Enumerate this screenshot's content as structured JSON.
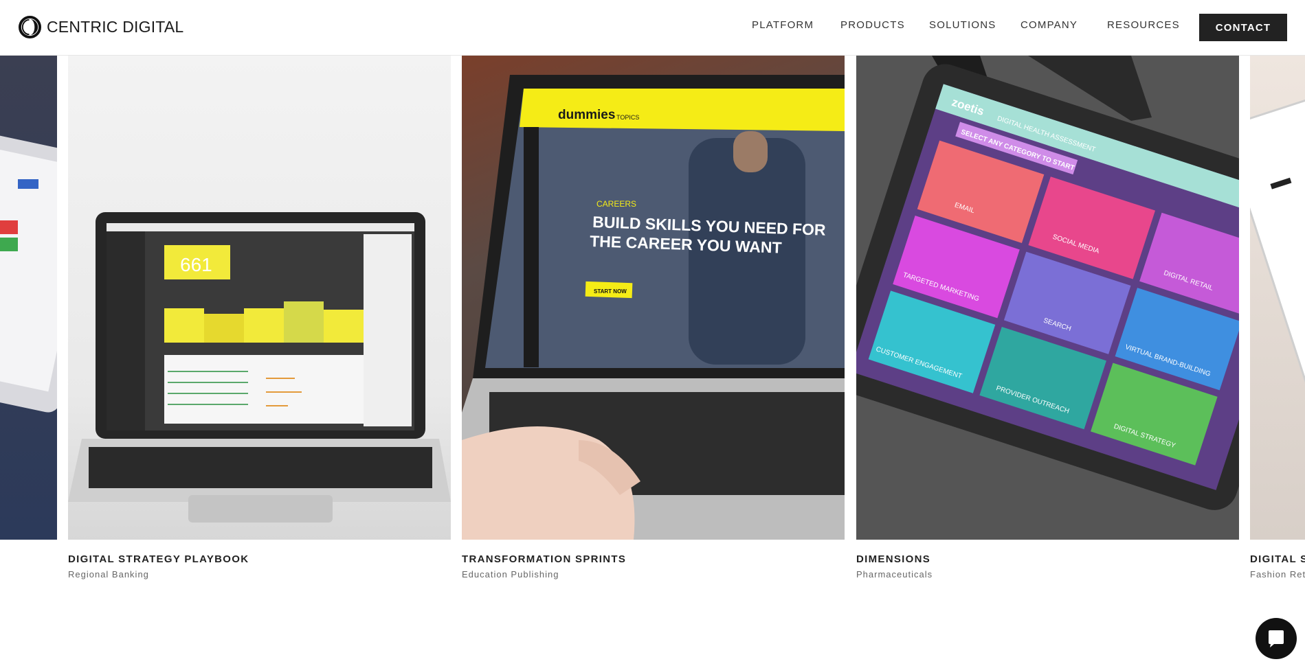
{
  "header": {
    "logo_text": "CENTRIC DIGITAL",
    "nav": [
      "PLATFORM",
      "PRODUCTS",
      "SOLUTIONS",
      "COMPANY",
      "RESOURCES"
    ],
    "contact_label": "CONTACT"
  },
  "cards": [
    {
      "title": "DIGITAL STRATEGY PLAYBOOK",
      "subtitle": "Regional Banking"
    },
    {
      "title": "TRANSFORMATION SPRINTS",
      "subtitle": "Education Publishing"
    },
    {
      "title": "DIMENSIONS",
      "subtitle": "Pharmaceuticals"
    },
    {
      "title": "DIGITAL S",
      "subtitle": "Fashion Ret"
    }
  ],
  "screens": {
    "bank": {
      "score": "661",
      "bars": [
        "676",
        "548",
        "662",
        "790",
        "636"
      ]
    },
    "edu": {
      "brand": "dummies",
      "menu": "TOPICS",
      "kicker": "CAREERS",
      "headline_1": "BUILD SKILLS YOU NEED FOR",
      "headline_2": "THE CAREER YOU WANT",
      "cta": "START NOW"
    },
    "pharma": {
      "brand": "zoetis",
      "app_title": "DIGITAL HEALTH ASSESSMENT",
      "banner": "SELECT ANY CATEGORY TO START",
      "tiles": [
        "EMAIL",
        "SOCIAL MEDIA",
        "TARGETED MARKETING",
        "SEARCH",
        "DIGITAL RETAIL",
        "CUSTOMER ENGAGEMENT",
        "PROVIDER OUTREACH",
        "VIRTUAL BRAND-BUILDING",
        "DIGITAL STRATEGY"
      ]
    }
  },
  "colors": {
    "header_bg": "#ffffff",
    "contact_bg": "#222222",
    "dummies_yellow": "#f5ec16",
    "tile_email": "#ef6b73",
    "tile_social": "#e8478c",
    "tile_targeted": "#d94ae0",
    "tile_search": "#7b6fd6",
    "tile_retail": "#c55ad8",
    "tile_engagement": "#35c2cf",
    "tile_outreach": "#2fa7a0",
    "tile_virtual": "#3f8fe0",
    "tile_strategy": "#5cbf5a"
  },
  "chat": {
    "icon": "chat-bubble-icon"
  }
}
